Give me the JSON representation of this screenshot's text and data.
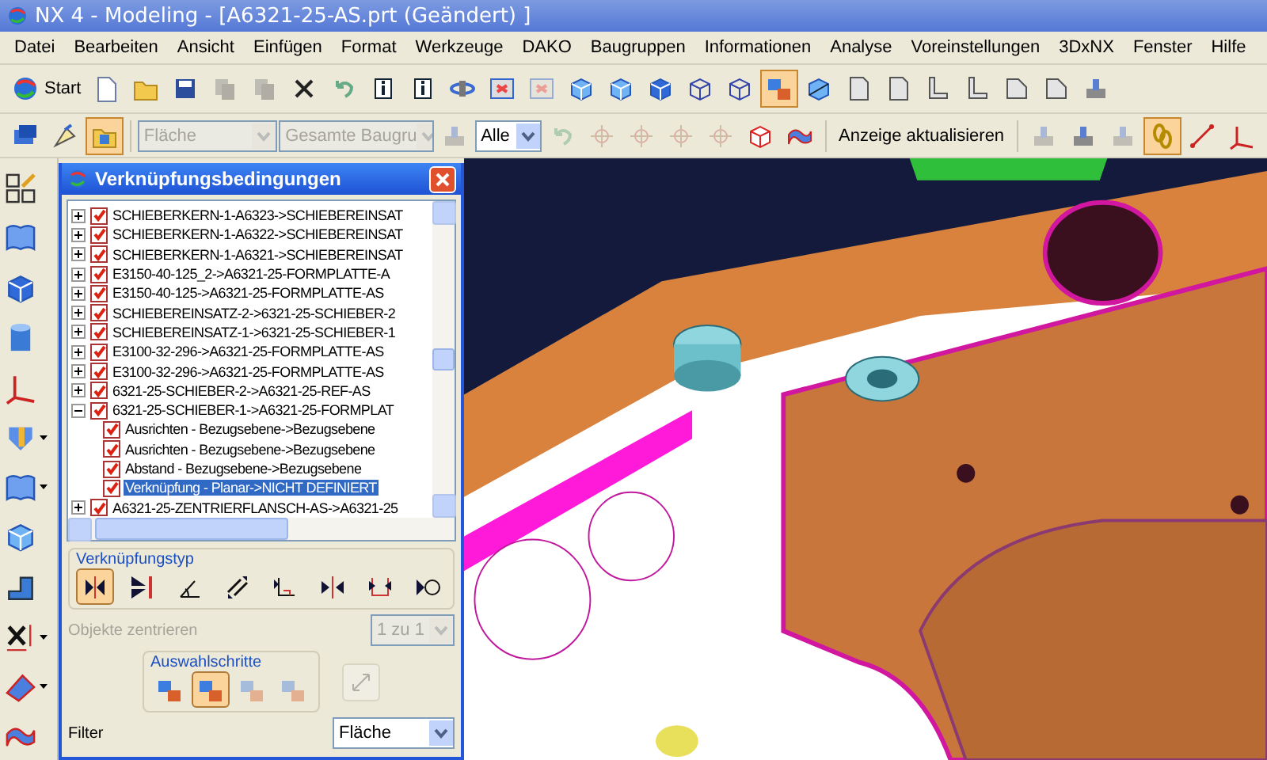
{
  "window": {
    "title": "NX 4 - Modeling - [A6321-25-AS.prt (Geändert) ]"
  },
  "menu": [
    "Datei",
    "Bearbeiten",
    "Ansicht",
    "Einfügen",
    "Format",
    "Werkzeuge",
    "DAKO",
    "Baugruppen",
    "Informationen",
    "Analyse",
    "Voreinstellungen",
    "3DxNX",
    "Fenster",
    "Hilfe"
  ],
  "toolbar_1": [
    {
      "kind": "start",
      "label": "Start",
      "selected": false,
      "disabled": false
    },
    {
      "kind": "doc",
      "selected": false,
      "disabled": false
    },
    {
      "kind": "folder",
      "selected": false,
      "disabled": false
    },
    {
      "kind": "save",
      "selected": false,
      "disabled": false
    },
    {
      "kind": "copy",
      "selected": false,
      "disabled": true
    },
    {
      "kind": "paste",
      "selected": false,
      "disabled": true
    },
    {
      "kind": "delete",
      "selected": false,
      "disabled": false
    },
    {
      "kind": "undo",
      "selected": false,
      "disabled": false
    },
    {
      "kind": "info-object",
      "selected": false,
      "disabled": false
    },
    {
      "kind": "info",
      "selected": false,
      "disabled": false
    },
    {
      "kind": "rotate",
      "selected": false,
      "disabled": false
    },
    {
      "kind": "window",
      "selected": false,
      "disabled": false
    },
    {
      "kind": "window",
      "selected": false,
      "disabled": true
    },
    {
      "kind": "cube",
      "selected": false,
      "disabled": false
    },
    {
      "kind": "cube",
      "selected": false,
      "disabled": false
    },
    {
      "kind": "cube-shaded",
      "selected": false,
      "disabled": false
    },
    {
      "kind": "cube-wire",
      "selected": false,
      "disabled": false
    },
    {
      "kind": "cube-wire",
      "selected": false,
      "disabled": false
    },
    {
      "kind": "cube-pair",
      "selected": true,
      "disabled": false
    },
    {
      "kind": "cube-section",
      "selected": false,
      "disabled": false
    },
    {
      "kind": "sheet",
      "selected": false,
      "disabled": false
    },
    {
      "kind": "sheet",
      "selected": false,
      "disabled": false
    },
    {
      "kind": "l-shape",
      "selected": false,
      "disabled": false
    },
    {
      "kind": "l-shape",
      "selected": false,
      "disabled": false
    },
    {
      "kind": "chamfer",
      "selected": false,
      "disabled": false
    },
    {
      "kind": "chamfer",
      "selected": false,
      "disabled": false
    },
    {
      "kind": "clamp",
      "selected": false,
      "disabled": false
    }
  ],
  "toolbar_2": {
    "tools_left": [
      {
        "kind": "assembly",
        "selected": false,
        "disabled": false
      },
      {
        "kind": "brush",
        "selected": false,
        "disabled": false
      },
      {
        "kind": "folder-part",
        "selected": true,
        "disabled": false
      }
    ],
    "type_filter": {
      "value": "Fläche",
      "disabled": true
    },
    "scope": {
      "value": "Gesamte Baugru",
      "disabled": true
    },
    "tools_mid": [
      {
        "kind": "drop",
        "selected": false,
        "disabled": true
      }
    ],
    "selection": {
      "value": "Alle",
      "disabled": false
    },
    "tools_right": [
      {
        "kind": "undo",
        "selected": false,
        "disabled": true
      },
      {
        "kind": "snap",
        "selected": false,
        "disabled": true
      },
      {
        "kind": "snap",
        "selected": false,
        "disabled": true
      },
      {
        "kind": "snap",
        "selected": false,
        "disabled": true
      },
      {
        "kind": "snap",
        "selected": false,
        "disabled": true
      },
      {
        "kind": "cube-red",
        "selected": false,
        "disabled": false
      },
      {
        "kind": "surface",
        "selected": false,
        "disabled": false
      }
    ],
    "refresh": "Anzeige aktualisieren",
    "tools_end": [
      {
        "kind": "clamp",
        "selected": false,
        "disabled": true
      },
      {
        "kind": "clamp",
        "selected": false,
        "disabled": false
      },
      {
        "kind": "clamp",
        "selected": false,
        "disabled": true
      },
      {
        "kind": "chain",
        "selected": true,
        "disabled": false
      },
      {
        "kind": "line",
        "selected": false,
        "disabled": false
      },
      {
        "kind": "axes",
        "selected": false,
        "disabled": false
      }
    ]
  },
  "side_toolbar": [
    {
      "kind": "sketch",
      "menu": false
    },
    {
      "kind": "book",
      "menu": false
    },
    {
      "kind": "cube-shaded",
      "menu": false
    },
    {
      "kind": "cylinder",
      "menu": false
    },
    {
      "kind": "axes",
      "menu": false
    },
    {
      "kind": "mold",
      "menu": true
    },
    {
      "kind": "book",
      "menu": true
    },
    {
      "kind": "cube",
      "menu": false
    },
    {
      "kind": "step",
      "menu": false
    },
    {
      "kind": "dimension",
      "menu": true
    },
    {
      "kind": "sweep",
      "menu": true
    },
    {
      "kind": "surface",
      "menu": false
    }
  ],
  "dialog": {
    "title": "Verknüpfungsbedingungen",
    "tree": [
      {
        "label": "SCHIEBERKERN-1-A6323->SCHIEBEREINSAT",
        "checked": true,
        "expanded": false,
        "selected": false
      },
      {
        "label": "SCHIEBERKERN-1-A6322->SCHIEBEREINSAT",
        "checked": true,
        "expanded": false,
        "selected": false
      },
      {
        "label": "SCHIEBERKERN-1-A6321->SCHIEBEREINSAT",
        "checked": true,
        "expanded": false,
        "selected": false
      },
      {
        "label": "E3150-40-125_2->A6321-25-FORMPLATTE-A",
        "checked": true,
        "expanded": false,
        "selected": false
      },
      {
        "label": "E3150-40-125->A6321-25-FORMPLATTE-AS",
        "checked": true,
        "expanded": false,
        "selected": false
      },
      {
        "label": "SCHIEBEREINSATZ-2->6321-25-SCHIEBER-2",
        "checked": true,
        "expanded": false,
        "selected": false
      },
      {
        "label": "SCHIEBEREINSATZ-1->6321-25-SCHIEBER-1",
        "checked": true,
        "expanded": false,
        "selected": false
      },
      {
        "label": "E3100-32-296->A6321-25-FORMPLATTE-AS",
        "checked": true,
        "expanded": false,
        "selected": false
      },
      {
        "label": "E3100-32-296->A6321-25-FORMPLATTE-AS",
        "checked": true,
        "expanded": false,
        "selected": false
      },
      {
        "label": "6321-25-SCHIEBER-2->A6321-25-REF-AS",
        "checked": true,
        "expanded": false,
        "selected": false
      },
      {
        "label": "6321-25-SCHIEBER-1->A6321-25-FORMPLAT",
        "checked": true,
        "expanded": true,
        "selected": false,
        "children": [
          {
            "label": "Ausrichten - Bezugsebene->Bezugsebene",
            "checked": true,
            "selected": false
          },
          {
            "label": "Ausrichten - Bezugsebene->Bezugsebene",
            "checked": true,
            "selected": false
          },
          {
            "label": "Abstand - Bezugsebene->Bezugsebene",
            "checked": true,
            "selected": false
          },
          {
            "label": "Verknüpfung - Planar->NICHT DEFINIERT",
            "checked": true,
            "selected": true
          }
        ]
      },
      {
        "label": "A6321-25-ZENTRIERFLANSCH-AS->A6321-25",
        "checked": true,
        "expanded": false,
        "selected": false
      }
    ],
    "type_group": {
      "title": "Verknüpfungstyp",
      "types": [
        {
          "kind": "mate",
          "selected": true
        },
        {
          "kind": "align",
          "selected": false
        },
        {
          "kind": "angle",
          "selected": false
        },
        {
          "kind": "parallel",
          "selected": false
        },
        {
          "kind": "perpendicular",
          "selected": false
        },
        {
          "kind": "center",
          "selected": false
        },
        {
          "kind": "distance",
          "selected": false
        },
        {
          "kind": "tangent",
          "selected": false
        }
      ]
    },
    "center_objects": {
      "label": "Objekte zentrieren",
      "value": "1 zu 1",
      "disabled": true
    },
    "steps_group": {
      "title": "Auswahlschritte",
      "steps": [
        {
          "selected": false,
          "disabled": false
        },
        {
          "selected": true,
          "disabled": false
        },
        {
          "selected": false,
          "disabled": true
        },
        {
          "selected": false,
          "disabled": true
        }
      ]
    },
    "reverse": {
      "disabled": true
    },
    "filter": {
      "label": "Filter",
      "value": "Fläche"
    }
  }
}
